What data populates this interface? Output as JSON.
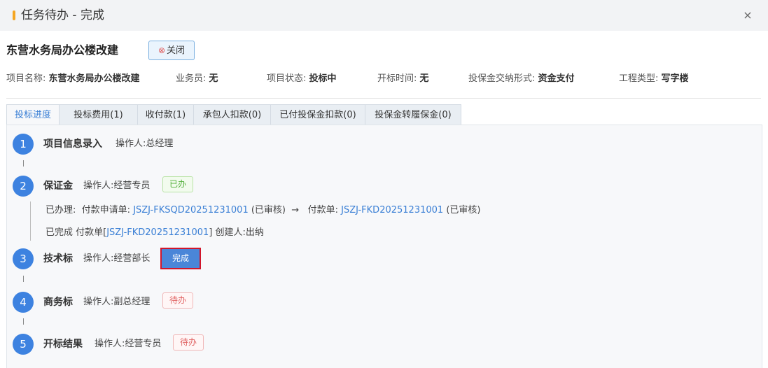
{
  "window": {
    "title": "任务待办 - 完成",
    "close_glyph": "×"
  },
  "project_title": "东营水务局办公楼改建",
  "close_button": {
    "label": "关闭"
  },
  "info": [
    {
      "label": "项目名称: ",
      "value": "东营水务局办公楼改建"
    },
    {
      "label": "业务员: ",
      "value": "无"
    },
    {
      "label": "项目状态: ",
      "value": "投标中"
    },
    {
      "label": "开标时间: ",
      "value": "无"
    },
    {
      "label": "投保金交纳形式: ",
      "value": "资金支付"
    },
    {
      "label": "工程类型: ",
      "value": "写字楼"
    }
  ],
  "tabs": [
    {
      "label": "投标进度",
      "active": true
    },
    {
      "label": "投标费用(1)"
    },
    {
      "label": "收付款(1)"
    },
    {
      "label": "承包人扣款(0)"
    },
    {
      "label": "已付投保金扣款(0)"
    },
    {
      "label": "投保金转履保金(0)"
    }
  ],
  "steps": [
    {
      "num": "1",
      "name": "项目信息录入",
      "operator": "操作人:总经理"
    },
    {
      "num": "2",
      "name": "保证金",
      "operator": "操作人:经营专员",
      "tag": "已办",
      "tag_status": "done"
    },
    {
      "num": "3",
      "name": "技术标",
      "operator": "操作人:经营部长",
      "button": "完成"
    },
    {
      "num": "4",
      "name": "商务标",
      "operator": "操作人:副总经理",
      "tag": "待办",
      "tag_status": "pending"
    },
    {
      "num": "5",
      "name": "开标结果",
      "operator": "操作人:经营专员",
      "tag": "待办",
      "tag_status": "pending"
    }
  ],
  "step2_details": {
    "line1": {
      "prefix": "已办理:",
      "apply_label": "付款申请单:",
      "apply_link": "JSZJ-FKSQD20251231001",
      "apply_status": "(已审核)",
      "arrow": "→",
      "pay_label": "付款单:",
      "pay_link": "JSZJ-FKD20251231001",
      "pay_status": "(已审核)"
    },
    "line2": {
      "prefix": "已完成 付款单[",
      "link": "JSZJ-FKD20251231001",
      "suffix": "] 创建人:出纳"
    }
  }
}
